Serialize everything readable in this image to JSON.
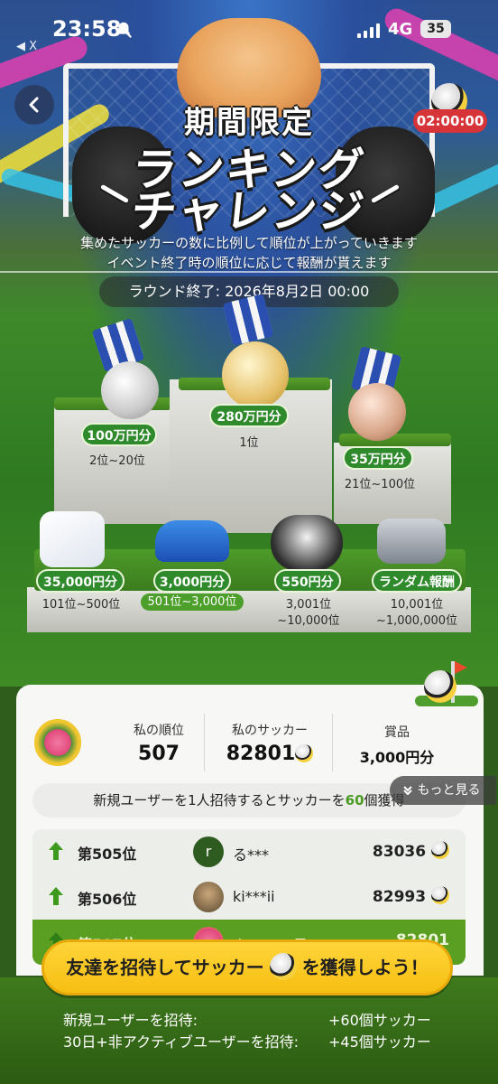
{
  "status_bar": {
    "back_app": "◀ X",
    "time": "23:58",
    "network": "4G",
    "battery": "35"
  },
  "event": {
    "title_line1": "期間限定",
    "title_line2": "ランキング",
    "title_line3": "チャレンジ",
    "timer": "02:00:00",
    "desc_line1": "集めたサッカーの数に比例して順位が上がっていきます",
    "desc_line2": "イベント終了時の順位に応じて報酬が貰えます",
    "round_end": "ラウンド終了: 2026年8月2日 00:00"
  },
  "podium": {
    "first": {
      "prize": "280万円分",
      "rank": "1位"
    },
    "second": {
      "prize": "100万円分",
      "rank": "2位~20位"
    },
    "third": {
      "prize": "35万円分",
      "rank": "21位~100位"
    },
    "tier4": {
      "prize": "35,000円分",
      "rank": "101位~500位"
    },
    "tier5": {
      "prize": "3,000円分",
      "rank": "501位~3,000位"
    },
    "tier6": {
      "prize": "550円分",
      "rank_line1": "3,001位",
      "rank_line2": "~10,000位"
    },
    "tier7": {
      "prize": "ランダム報酬",
      "rank_line1": "10,001位",
      "rank_line2": "~1,000,000位"
    }
  },
  "my_stats": {
    "rank_label": "私の順位",
    "rank_value": "507",
    "soccer_label": "私のサッカー",
    "soccer_value": "82801",
    "prize_label": "賞品",
    "prize_value": "3,000円分"
  },
  "invite_note": {
    "prefix": "新規ユーザーを1人招待するとサッカーを",
    "number": "60",
    "suffix": "個獲得"
  },
  "more_label": "もっと見る",
  "leaderboard": [
    {
      "position": "第505位",
      "avatar_letter": "r",
      "name": "る***",
      "score": "83036"
    },
    {
      "position": "第506位",
      "avatar_letter": "",
      "name": "ki***ii",
      "score": "82993"
    },
    {
      "position": "第507位",
      "avatar_letter": "",
      "name": "ウス***A君",
      "score": "82801"
    }
  ],
  "cta": {
    "before": "友達を招待してサッカー",
    "after": "を獲得しよう！"
  },
  "rewards": {
    "line1_label": "新規ユーザーを招待:",
    "line1_value": "+60個サッカー",
    "line2_label": "30日+非アクティブユーザーを招待:",
    "line2_value": "+45個サッカー"
  }
}
